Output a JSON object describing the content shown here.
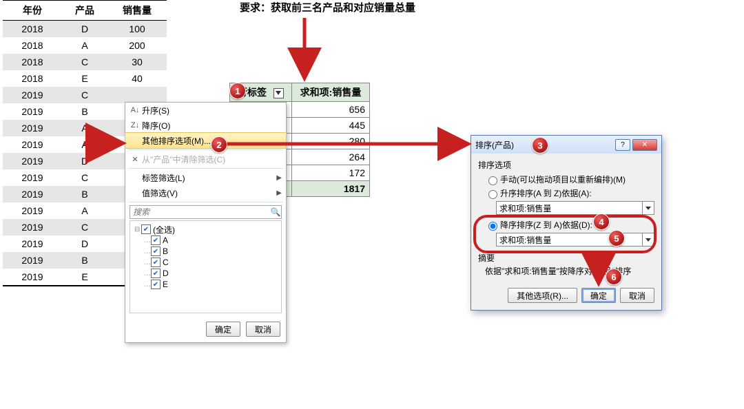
{
  "instruction": "要求：获取前三名产品和对应销量总量",
  "data_table": {
    "headers": [
      "年份",
      "产品",
      "销售量"
    ],
    "rows": [
      {
        "year": "2018",
        "prod": "D",
        "qty": "100",
        "shaded": true
      },
      {
        "year": "2018",
        "prod": "A",
        "qty": "200",
        "shaded": false
      },
      {
        "year": "2018",
        "prod": "C",
        "qty": "30",
        "shaded": true
      },
      {
        "year": "2018",
        "prod": "E",
        "qty": "40",
        "shaded": false
      },
      {
        "year": "2019",
        "prod": "C",
        "qty": "",
        "shaded": true
      },
      {
        "year": "2019",
        "prod": "B",
        "qty": "",
        "shaded": false
      },
      {
        "year": "2019",
        "prod": "A",
        "qty": "",
        "shaded": true
      },
      {
        "year": "2019",
        "prod": "A",
        "qty": "",
        "shaded": false
      },
      {
        "year": "2019",
        "prod": "D",
        "qty": "",
        "shaded": true
      },
      {
        "year": "2019",
        "prod": "C",
        "qty": "",
        "shaded": false
      },
      {
        "year": "2019",
        "prod": "B",
        "qty": "",
        "shaded": true
      },
      {
        "year": "2019",
        "prod": "A",
        "qty": "",
        "shaded": false
      },
      {
        "year": "2019",
        "prod": "C",
        "qty": "",
        "shaded": true
      },
      {
        "year": "2019",
        "prod": "D",
        "qty": "",
        "shaded": false
      },
      {
        "year": "2019",
        "prod": "B",
        "qty": "",
        "shaded": true
      },
      {
        "year": "2019",
        "prod": "E",
        "qty": "",
        "shaded": false
      }
    ]
  },
  "pivot": {
    "row_label_header": "行标签",
    "value_header": "求和项:销售量",
    "values": [
      "656",
      "445",
      "280",
      "264",
      "172"
    ],
    "total": "1817"
  },
  "context_menu": {
    "sort_asc": "升序(S)",
    "sort_desc": "降序(O)",
    "more_sort": "其他排序选项(M)...",
    "clear_filter": "从\"产品\"中清除筛选(C)",
    "label_filter": "标签筛选(L)",
    "value_filter": "值筛选(V)",
    "search_placeholder": "搜索",
    "select_all": "(全选)",
    "items": [
      "A",
      "B",
      "C",
      "D",
      "E"
    ],
    "ok": "确定",
    "cancel": "取消"
  },
  "dialog": {
    "title": "排序(产品)",
    "group": "排序选项",
    "opt_manual": "手动(可以拖动项目以重新编排)(M)",
    "opt_asc": "升序排序(A 到 Z)依据(A):",
    "opt_desc": "降序排序(Z 到 A)依据(D):",
    "select_value": "求和项:销售量",
    "summary_label": "摘要",
    "summary_text": "依据\"求和项:销售量\"按降序对\"产品\"排序",
    "btn_more": "其他选项(R)...",
    "btn_ok": "确定",
    "btn_cancel": "取消"
  },
  "badges": {
    "b1": "1",
    "b2": "2",
    "b3": "3",
    "b4": "4",
    "b5": "5",
    "b6": "6"
  }
}
